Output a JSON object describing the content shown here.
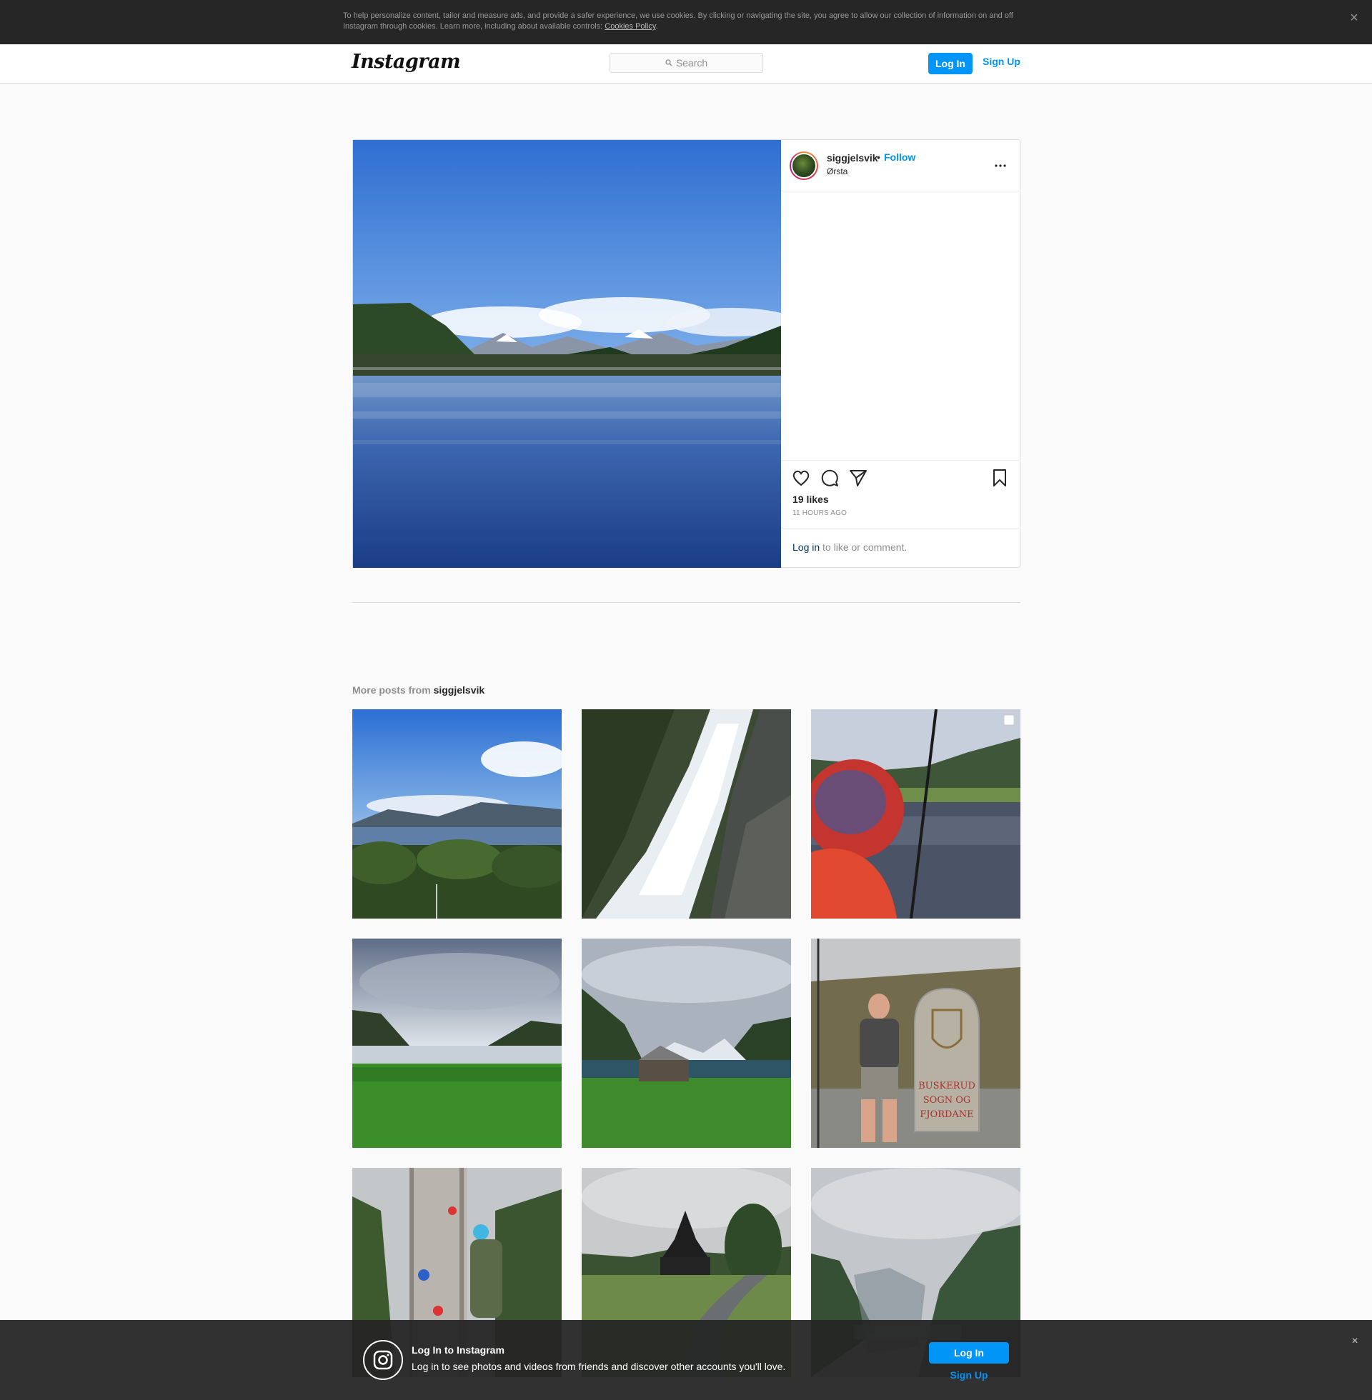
{
  "cookie_banner": {
    "text": "To help personalize content, tailor and measure ads, and provide a safer experience, we use cookies. By clicking or navigating the site, you agree to allow our collection of information on and off Instagram through cookies. Learn more, including about available controls: ",
    "link": "Cookies Policy",
    "end": ".",
    "close": "×"
  },
  "header": {
    "logo": "Instagram",
    "search_placeholder": "Search",
    "login": "Log In",
    "signup": "Sign Up"
  },
  "post": {
    "username": "siggjelsvik",
    "dot": "•",
    "follow": "Follow",
    "location": "Ørsta",
    "likes": "19 likes",
    "time": "11 HOURS AGO",
    "login_link": "Log in",
    "login_rest": " to like or comment."
  },
  "more_posts": {
    "prefix": "More posts from ",
    "username": "siggjelsvik"
  },
  "grid": [
    {
      "scene": "lake-view-forest"
    },
    {
      "scene": "waterfall"
    },
    {
      "scene": "fishing-lake"
    },
    {
      "scene": "cloudy-fjord-meadow"
    },
    {
      "scene": "barn-mountains"
    },
    {
      "scene": "man-with-milestone"
    },
    {
      "scene": "climbing-wall"
    },
    {
      "scene": "stave-church"
    },
    {
      "scene": "misty-valley"
    }
  ],
  "milestone_text": {
    "line1": "BUSKERUD",
    "line2": "SOGN OG",
    "line3": "FJORDANE"
  },
  "bottom_bar": {
    "title": "Log In to Instagram",
    "subtitle": "Log in to see photos and videos from friends and discover other accounts you'll love.",
    "login": "Log In",
    "signup": "Sign Up",
    "close": "×"
  },
  "colors": {
    "accent": "#0095f6",
    "banner_bg": "#262626"
  }
}
